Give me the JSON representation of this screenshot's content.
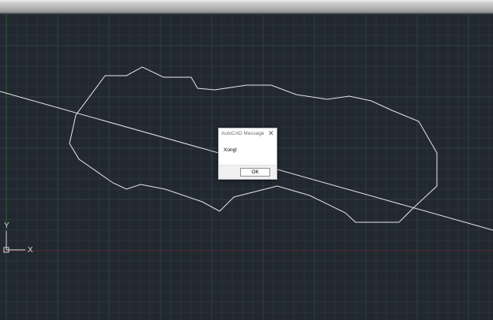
{
  "window": {
    "title_bar_label": ""
  },
  "drawing": {
    "background_color": "#212830",
    "grid_minor_color": "#2a323c",
    "grid_major_color": "#333c48",
    "x_axis_line_color": "#5a2a2a",
    "y_axis_line_color": "#2f5a36",
    "geometry_color": "#e6e6e6",
    "ucs_x_label": "X",
    "ucs_y_label": "Y"
  },
  "dialog": {
    "title": "AutoCAD Message",
    "message": "Xong!",
    "ok_label": "OK",
    "close_glyph": "✕"
  }
}
